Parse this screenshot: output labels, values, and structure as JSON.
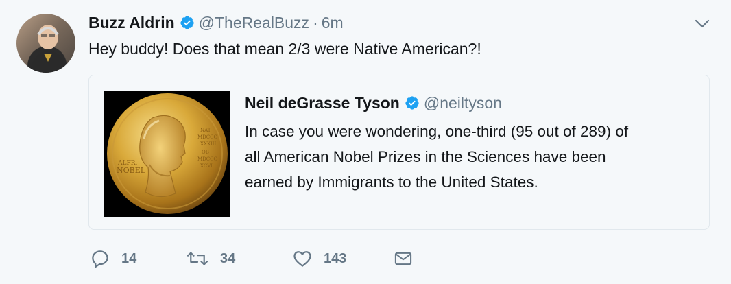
{
  "tweet": {
    "author_name": "Buzz Aldrin",
    "author_handle": "@TheRealBuzz",
    "separator": "·",
    "time": "6m",
    "text": "Hey buddy! Does that mean 2/3 were Native American?!",
    "verified": true
  },
  "quoted_tweet": {
    "author_name": "Neil deGrasse Tyson",
    "author_handle": "@neiltyson",
    "verified": true,
    "text_lines": [
      "In case you were wondering, one-third (95 out of 289) of",
      "all American Nobel Prizes in the Sciences have been",
      "earned by Immigrants to the United States."
    ],
    "image": {
      "label": "Nobel medal",
      "medal_left_text": "ALFR. NOBEL",
      "medal_right_text": "NAT MDCCC XXXIII OB MDCCC XCVI"
    }
  },
  "actions": {
    "reply_count": "14",
    "retweet_count": "34",
    "like_count": "143"
  },
  "colors": {
    "background": "#f5f8fa",
    "verified_blue": "#1da1f2",
    "secondary_text": "#657786",
    "border": "#e1e8ed"
  },
  "icons": [
    "reply-icon",
    "retweet-icon",
    "like-icon",
    "message-icon",
    "chevron-down-icon",
    "verified-badge-icon"
  ]
}
